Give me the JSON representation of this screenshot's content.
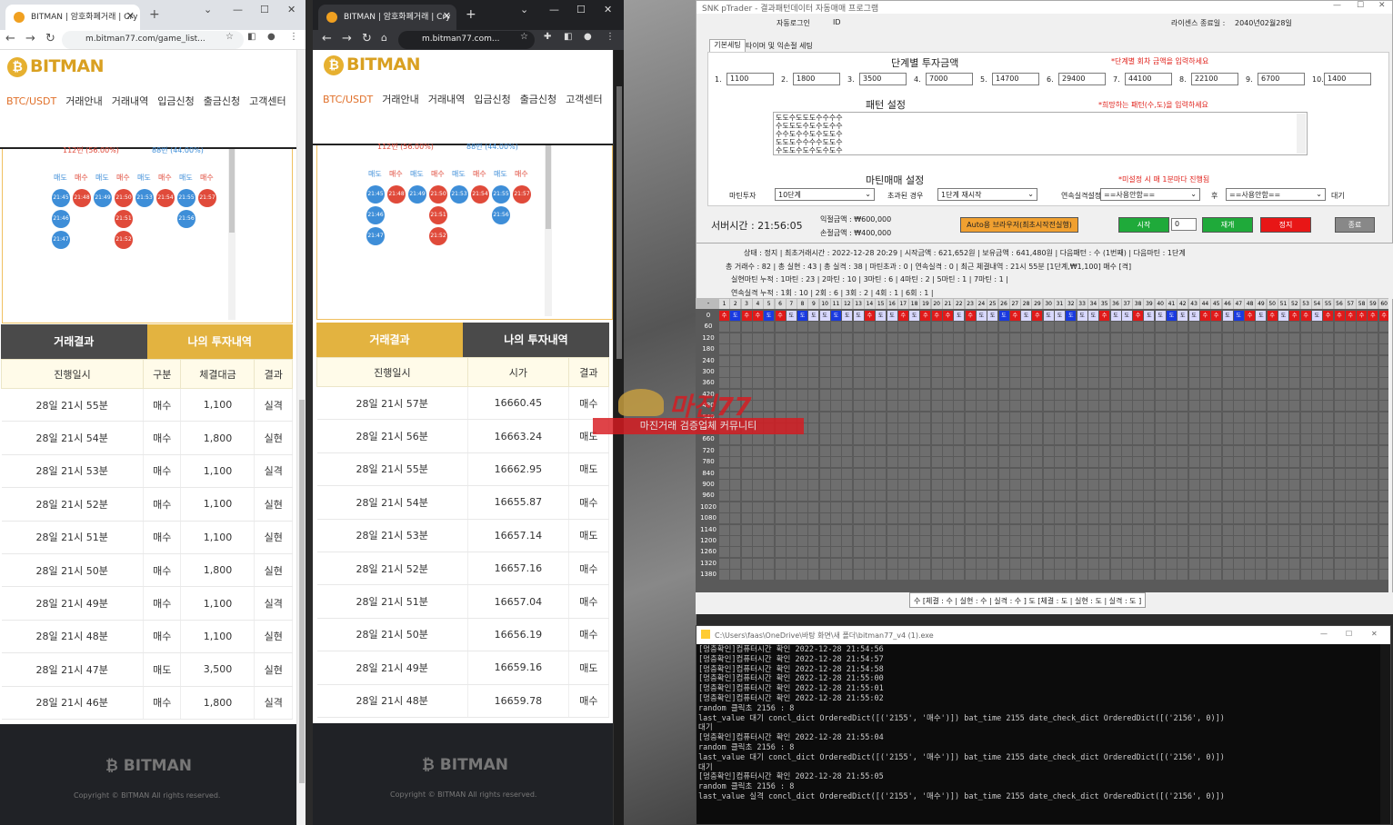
{
  "browser1": {
    "tab_title": "BITMAN | 암호화폐거래 | Cry",
    "url": "m.bitman77.com/game_list...",
    "logo": "BITMAN",
    "menu": [
      "BTC/USDT",
      "거래안내",
      "거래내역",
      "입금신청",
      "출금신청",
      "고객센터"
    ],
    "stats": [
      "112번 (56.00%)",
      "88번 (44.00%)"
    ],
    "col_labels": [
      "매도",
      "매수",
      "매도",
      "매수",
      "매도",
      "매수",
      "매도",
      "매수"
    ],
    "balls": [
      {
        "t": "21:45",
        "c": "bl"
      },
      {
        "t": "21:48",
        "c": "rd"
      },
      {
        "t": "21:49",
        "c": "bl"
      },
      {
        "t": "21:50",
        "c": "rd"
      },
      {
        "t": "21:53",
        "c": "bl"
      },
      {
        "t": "21:54",
        "c": "rd"
      },
      {
        "t": "21:55",
        "c": "bl"
      },
      {
        "t": "21:57",
        "c": "rd"
      },
      {
        "t": "21:46",
        "c": "bl"
      },
      {
        "t": "21:51",
        "c": "rd"
      },
      {
        "t": "21:56",
        "c": "bl"
      },
      {
        "t": "21:47",
        "c": "bl"
      },
      {
        "t": "21:52",
        "c": "rd"
      }
    ],
    "tab_left": "거래결과",
    "tab_right": "나의 투자내역",
    "headers": [
      "진행일시",
      "구분",
      "체결대금",
      "결과"
    ],
    "rows": [
      [
        "28일 21시 55분",
        "매수",
        "1,100",
        "실격"
      ],
      [
        "28일 21시 54분",
        "매수",
        "1,800",
        "실현"
      ],
      [
        "28일 21시 53분",
        "매수",
        "1,100",
        "실격"
      ],
      [
        "28일 21시 52분",
        "매수",
        "1,100",
        "실현"
      ],
      [
        "28일 21시 51분",
        "매수",
        "1,100",
        "실현"
      ],
      [
        "28일 21시 50분",
        "매수",
        "1,800",
        "실현"
      ],
      [
        "28일 21시 49분",
        "매수",
        "1,100",
        "실격"
      ],
      [
        "28일 21시 48분",
        "매수",
        "1,100",
        "실현"
      ],
      [
        "28일 21시 47분",
        "매도",
        "3,500",
        "실현"
      ],
      [
        "28일 21시 46분",
        "매수",
        "1,800",
        "실격"
      ]
    ],
    "footer_logo": "BITMAN",
    "copyright": "Copyright © BITMAN All rights reserved."
  },
  "browser2": {
    "tab_title": "BITMAN | 암호화폐거래 | Cry",
    "url": "m.bitman77.com...",
    "logo": "BITMAN",
    "menu": [
      "BTC/USDT",
      "거래안내",
      "거래내역",
      "입금신청",
      "출금신청",
      "고객센터"
    ],
    "stats": [
      "112번 (56.00%)",
      "88번 (44.00%)"
    ],
    "tab_left": "거래결과",
    "tab_right": "나의 투자내역",
    "headers": [
      "진행일시",
      "시가",
      "결과"
    ],
    "rows": [
      [
        "28일 21시 57분",
        "16660.45",
        "매수"
      ],
      [
        "28일 21시 56분",
        "16663.24",
        "매도"
      ],
      [
        "28일 21시 55분",
        "16662.95",
        "매도"
      ],
      [
        "28일 21시 54분",
        "16655.87",
        "매수"
      ],
      [
        "28일 21시 53분",
        "16657.14",
        "매도"
      ],
      [
        "28일 21시 52분",
        "16657.16",
        "매수"
      ],
      [
        "28일 21시 51분",
        "16657.04",
        "매수"
      ],
      [
        "28일 21시 50분",
        "16656.19",
        "매수"
      ],
      [
        "28일 21시 49분",
        "16659.16",
        "매도"
      ],
      [
        "28일 21시 48분",
        "16659.78",
        "매수"
      ]
    ],
    "footer_logo": "BITMAN",
    "copyright": "Copyright © BITMAN All rights reserved."
  },
  "trader": {
    "title": "SNK pTrader - 결과패턴데이터 자동매매 프로그램",
    "login_label": "자동로그인",
    "id_label": "ID",
    "license_label": "라이센스 종료일 :",
    "license_date": "2040년02월28일",
    "tabs": [
      "기본세팅",
      "타이머 및 익손절 세팅"
    ],
    "invest_title": "단계별 투자금액",
    "invest_hint": "*단계별 회차 금액을 입력하세요",
    "steps": [
      [
        "1.",
        "1100"
      ],
      [
        "2.",
        "1800"
      ],
      [
        "3.",
        "3500"
      ],
      [
        "4.",
        "7000"
      ],
      [
        "5.",
        "14700"
      ],
      [
        "6.",
        "29400"
      ],
      [
        "7.",
        "44100"
      ],
      [
        "8.",
        "22100"
      ],
      [
        "9.",
        "6700"
      ],
      [
        "10.",
        "1400"
      ]
    ],
    "pattern_title": "패턴 설정",
    "pattern_hint": "*희망하는 패턴(수,도)을 입력하세요",
    "pattern_lines": [
      "도도수도도도수수수수",
      "수도도도수도수도수수",
      "수수도수수도수도도수",
      "도도도수수수수도도수",
      "수도도수도수도수도수"
    ],
    "martin_title": "마틴매매 설정",
    "martin_hint": "*미설정 시 매 1분마다 진행됨",
    "martin_invest_label": "마틴투자",
    "martin_invest_value": "10단계",
    "exceed_label": "초과된 경우",
    "exceed_value": "1단계 재시작",
    "consec_label": "연속실격설정",
    "consec_value": "==사용안함==",
    "after_label": "후",
    "after_value": "==사용안함==",
    "wait_label": "대기",
    "server_time": "서버시간 : 21:56:05",
    "profit": "익절금액 : ₩600,000",
    "loss": "손절금액 : ₩400,000",
    "auto_btn": "Auto용 브라우저(최초시작전실행)",
    "start_btn": "시작",
    "start_input": "0",
    "reset_btn": "재개",
    "stop_btn": "정지",
    "end_btn": "종료",
    "status_lines": [
      "상태 : 정지     | 최초거래시간 : 2022-12-28 20:29   | 시작금액 :   621,652원        | 보유금액 :   641,480원        | 다음패턴 :  수 (1번째)    | 다음마틴 :  1단계",
      "총 거래수 : 82          | 총 실현 : 43          | 총 실격 : 38          | 마틴초과 : 0            | 연속실격 : 0            | 최근 체결내역 :  21시 55분 [1단계,₩1,100] 매수 [격]",
      "실현마틴 누적 :    1마틴 : 23 | 2마틴 : 10 | 3마틴 : 6 | 4마틴 : 2 | 5마틴 : 1 | 7마틴 : 1 |",
      "연속실격 누적 :    1회 : 10 | 2회 : 6 | 3회 : 2 | 4회 : 1 | 6회 : 1 |"
    ],
    "grid_row0": "수도수수도수도도도도도도도수도도수도수수수도수도도도수도수도도도도도수도도수도도도도도수수도도수도수도수수도수수수수수수도",
    "row_labels": [
      "0",
      "60",
      "120",
      "180",
      "240",
      "300",
      "360",
      "420",
      "480",
      "540",
      "600",
      "660",
      "720",
      "780",
      "840",
      "900",
      "960",
      "1020",
      "1080",
      "1140",
      "1200",
      "1260",
      "1320",
      "1380"
    ],
    "legend": "수 [체결 : 수 | 실현 : 수 | 실격 : 수 ]   도 [체결 : 도 | 실현 : 도 | 실격 : 도 ]"
  },
  "console": {
    "title": "C:\\Users\\faas\\OneDrive\\바탕 화면\\새 폴더\\bitman77_v4 (1).exe",
    "lines": [
      "[멍충확인]컴퓨터시간 확인 2022-12-28 21:54:56",
      "[멍충확인]컴퓨터시간 확인 2022-12-28 21:54:57",
      "[멍충확인]컴퓨터시간 확인 2022-12-28 21:54:58",
      "[멍충확인]컴퓨터시간 확인 2022-12-28 21:55:00",
      "[멍충확인]컴퓨터시간 확인 2022-12-28 21:55:01",
      "[멍충확인]컴퓨터시간 확인 2022-12-28 21:55:02",
      "random 클릭초 2156 : 8",
      "last_value 대기 concl_dict OrderedDict([('2155', '매수')]) bat_time 2155 date_check_dict OrderedDict([('2156', 0)])",
      "대기",
      "[멍충확인]컴퓨터시간 확인 2022-12-28 21:55:04",
      "random 클릭초 2156 : 8",
      "last_value 대기 concl_dict OrderedDict([('2155', '매수')]) bat_time 2155 date_check_dict OrderedDict([('2156', 0)])",
      "대기",
      "[멍충확인]컴퓨터시간 확인 2022-12-28 21:55:05",
      "random 클릭초 2156 : 8",
      "last_value 실격 concl_dict OrderedDict([('2155', '매수')]) bat_time 2155 date_check_dict OrderedDict([('2156', 0)])"
    ]
  },
  "watermark": {
    "title": "마진77",
    "subtitle": "마진거래 검증업체 커뮤니티"
  }
}
